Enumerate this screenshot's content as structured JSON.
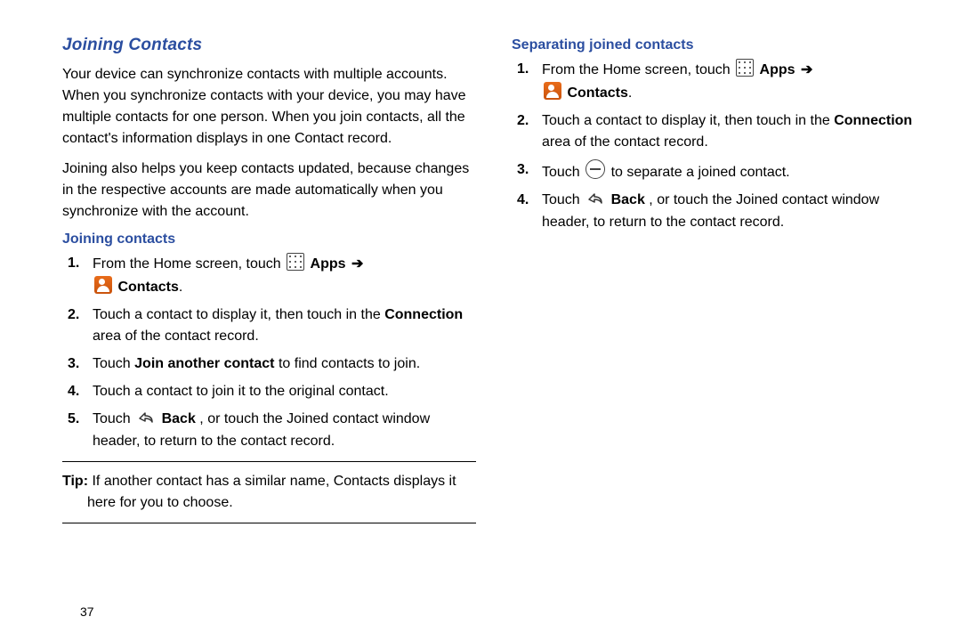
{
  "left": {
    "heading": "Joining Contacts",
    "para1": "Your device can synchronize contacts with multiple accounts. When you synchronize contacts with your device, you may have multiple contacts for one person. When you join contacts, all the contact's information displays in one Contact record.",
    "para2": "Joining also helps you keep contacts updated, because changes in the respective accounts are made automatically when you synchronize with the account.",
    "sub": "Joining contacts",
    "steps": {
      "s1a": "From the Home screen, touch ",
      "s1_apps": "Apps",
      "s1_contacts": "Contacts",
      "s2a": "Touch a contact to display it, then touch in the ",
      "s2_conn": "Connection",
      "s2b": " area of the contact record.",
      "s3a": "Touch ",
      "s3_join": "Join another contact",
      "s3b": " to find contacts to join.",
      "s4": "Touch a contact to join it to the original contact.",
      "s5a": "Touch ",
      "s5_back": "Back",
      "s5b": ", or touch the Joined contact window header, to return to the contact record."
    },
    "tip_label": "Tip:",
    "tip_body": " If another contact has a similar name, Contacts displays it",
    "tip_body2": "here for you to choose."
  },
  "right": {
    "sub": "Separating joined contacts",
    "steps": {
      "s1a": "From the Home screen, touch ",
      "s1_apps": "Apps",
      "s1_contacts": "Contacts",
      "s2a": "Touch a contact to display it, then touch in the ",
      "s2_conn": "Connection",
      "s2b": " area of the contact record.",
      "s3a": "Touch ",
      "s3b": " to separate a joined contact.",
      "s4a": "Touch ",
      "s4_back": "Back",
      "s4b": ", or touch the Joined contact window header, to return to the contact record."
    }
  },
  "arrow": " ➔",
  "period": ".",
  "page_number": "37"
}
